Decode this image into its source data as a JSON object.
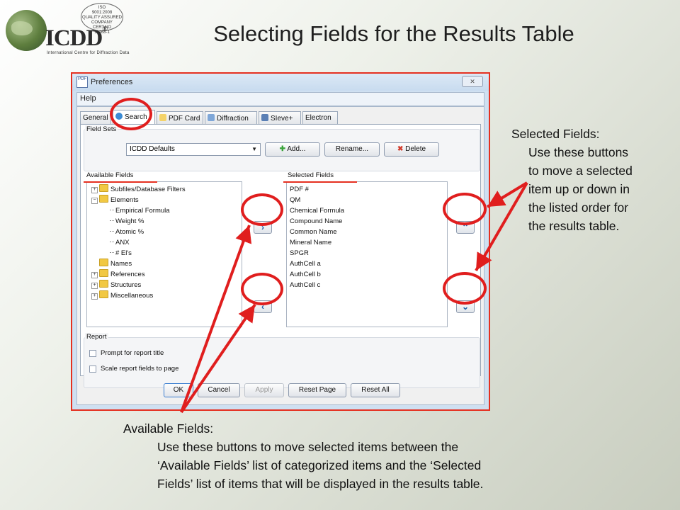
{
  "logo": {
    "brand": "ICDD",
    "reg": "®",
    "sub": "International Centre for Diffraction Data",
    "iso_lines": [
      "ISO",
      "9001:2008",
      "QUALITY ASSURED COMPANY",
      "CERT.NO",
      "11468-1"
    ]
  },
  "slide_title": "Selecting Fields for the Results Table",
  "window": {
    "title": "Preferences",
    "close": "✕",
    "menu": "Help",
    "tabs": [
      "General",
      "Search",
      "PDF Card",
      "Diffraction",
      "SIeve+",
      "Electron"
    ],
    "field_sets": {
      "label": "Field Sets",
      "combo_value": "ICDD Defaults",
      "add": "Add...",
      "rename": "Rename...",
      "delete": "Delete"
    },
    "available": {
      "label": "Available Fields",
      "items": [
        {
          "text": "Subfiles/Database Filters",
          "kind": "folder",
          "exp": "+"
        },
        {
          "text": "Elements",
          "kind": "folder",
          "exp": "−"
        },
        {
          "text": "Empirical Formula",
          "kind": "leaf"
        },
        {
          "text": "Weight %",
          "kind": "leaf"
        },
        {
          "text": "Atomic %",
          "kind": "leaf"
        },
        {
          "text": "ANX",
          "kind": "leaf"
        },
        {
          "text": "# El's",
          "kind": "leaf"
        },
        {
          "text": "Names",
          "kind": "folder",
          "exp": ""
        },
        {
          "text": "References",
          "kind": "folder",
          "exp": "+"
        },
        {
          "text": "Structures",
          "kind": "folder",
          "exp": "+"
        },
        {
          "text": "Miscellaneous",
          "kind": "folder",
          "exp": "+"
        }
      ]
    },
    "selected": {
      "label": "Selected Fields",
      "items": [
        "PDF #",
        "QM",
        "Chemical Formula",
        "Compound Name",
        "Common Name",
        "Mineral Name",
        "SPGR",
        "AuthCell a",
        "AuthCell b",
        "AuthCell c"
      ]
    },
    "move_right": "›",
    "move_left": "‹",
    "move_up": "⌃",
    "move_down": "⌄",
    "report": {
      "label": "Report",
      "opt1": "Prompt for report title",
      "opt2": "Scale report fields to page"
    },
    "buttons": {
      "ok": "OK",
      "cancel": "Cancel",
      "apply": "Apply",
      "reset_page": "Reset Page",
      "reset_all": "Reset All"
    }
  },
  "annotations": {
    "selected_heading": "Selected Fields:",
    "selected_lines": [
      "Use these buttons",
      "to move a selected",
      "item up or down in",
      "the listed order for",
      "the results table."
    ],
    "available_heading": "Available Fields:",
    "available_lines": [
      "Use these buttons to move selected items between the",
      "‘Available Fields’ list of categorized items and the ‘Selected",
      "Fields’ list of items that will be displayed in the results table."
    ]
  },
  "colors": {
    "highlight": "#e01e1e",
    "window_border": "#e53020",
    "arrow_icon": "#1f5ea8"
  }
}
